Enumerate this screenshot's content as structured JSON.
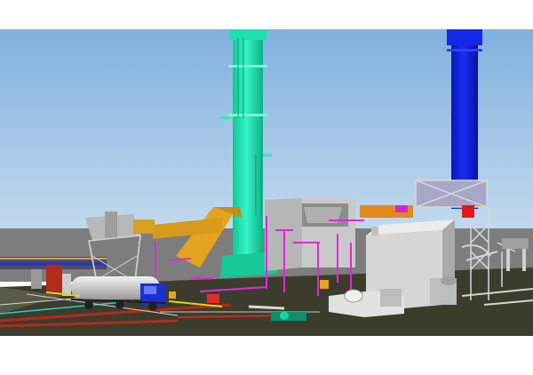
{
  "scene": {
    "colors": {
      "sky": "#a9c9e6",
      "sky_top": "#7fb1de",
      "ground": "#3c3c2c",
      "far_ground": "#7d7d7d",
      "stack_green": "#19e8b0",
      "stack_blue": "#0a1ee0",
      "structure_grey": "#c9c9c9",
      "pipe_magenta": "#e028d8",
      "duct_yellow": "#e3a51e",
      "tanker_blue": "#1c2fd4",
      "road_red": "#b22a1a"
    }
  }
}
